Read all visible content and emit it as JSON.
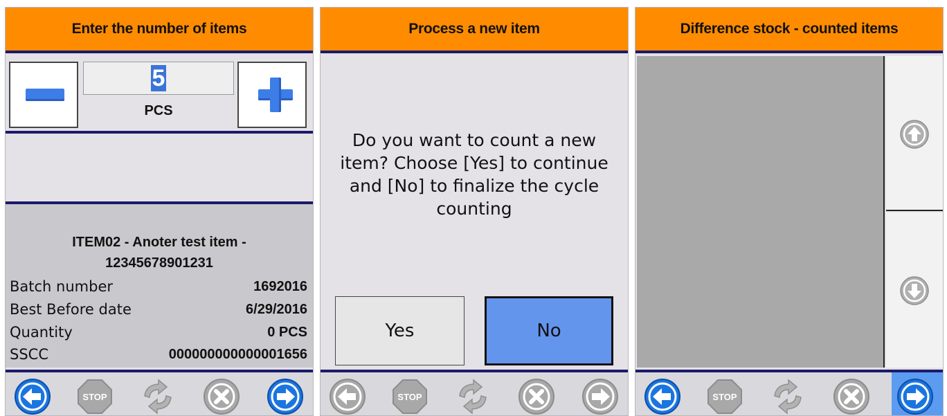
{
  "panels": {
    "quantity": {
      "title": "Enter the number of items",
      "quantity_value": "5",
      "unit": "PCS",
      "item_title": "ITEM02 - Anoter test item - 12345678901231",
      "fields": [
        {
          "label": "Batch number",
          "value": "1692016"
        },
        {
          "label": "Best Before date",
          "value": "6/29/2016"
        },
        {
          "label": "Quantity",
          "value": "0 PCS"
        },
        {
          "label": "SSCC",
          "value": "000000000000001656"
        }
      ]
    },
    "process": {
      "title": "Process a new item",
      "question": "Do you want to count a new item? Choose [Yes] to continue and [No] to finalize the cycle counting",
      "yes_label": "Yes",
      "no_label": "No"
    },
    "difference": {
      "title": "Difference stock - counted items"
    }
  },
  "nav_icons": [
    "back-icon",
    "stop-icon",
    "refresh-icon",
    "cancel-icon",
    "forward-icon"
  ],
  "stop_text": "STOP",
  "colors": {
    "header": "#ff8c00",
    "nav_active": "#1a75e0",
    "nav_disabled": "#a8a8a8",
    "no_button": "#6495ed",
    "separator": "#1c1a6a"
  }
}
